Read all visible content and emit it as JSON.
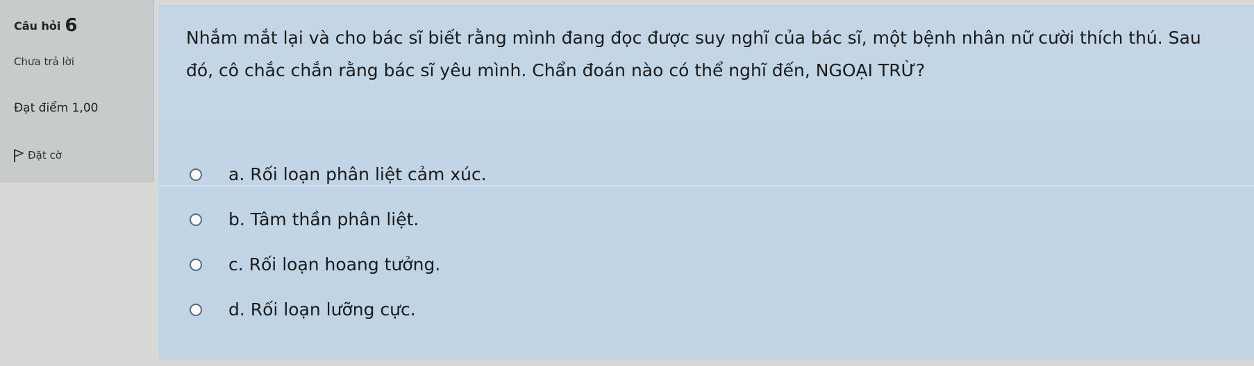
{
  "info": {
    "question_label": "Câu hỏi",
    "question_number": "6",
    "state": "Chưa trả lời",
    "grade": "Đạt điểm 1,00",
    "flag_label": "Đặt cờ"
  },
  "question": {
    "text": "Nhắm mắt lại và cho bác sĩ biết rằng mình đang đọc được suy nghĩ của bác sĩ, một bệnh nhân nữ cười thích thú. Sau đó, cô chắc chắn rằng bác sĩ yêu mình. Chẩn đoán nào có thể nghĩ đến, NGOẠI TRỪ?"
  },
  "answers": [
    {
      "label": "a. Rối loạn phân liệt cảm xúc."
    },
    {
      "label": "b. Tâm thần phân liệt."
    },
    {
      "label": "c. Rối loạn hoang tưởng."
    },
    {
      "label": "d. Rối loạn lưỡng cực."
    }
  ],
  "icons": {
    "flag": "flag-icon",
    "radio": "radio-icon"
  }
}
